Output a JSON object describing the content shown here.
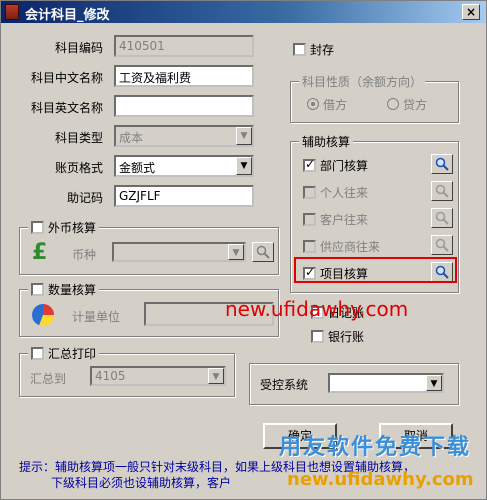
{
  "window": {
    "title": "会计科目_修改",
    "close_label": "×"
  },
  "fields": {
    "code_label": "科目编码",
    "code_value": "410501",
    "cn_name_label": "科目中文名称",
    "cn_name_value": "工资及福利费",
    "en_name_label": "科目英文名称",
    "en_name_value": "",
    "type_label": "科目类型",
    "type_value": "成本",
    "format_label": "账页格式",
    "format_value": "金额式",
    "mnemonic_label": "助记码",
    "mnemonic_value": "GZJFLF"
  },
  "seal": {
    "label": "封存"
  },
  "nature": {
    "title": "科目性质（余额方向）",
    "debit": "借方",
    "credit": "贷方"
  },
  "aux": {
    "title": "辅助核算",
    "items": [
      {
        "label": "部门核算",
        "checked": true,
        "enabled": true
      },
      {
        "label": "个人往来",
        "checked": false,
        "enabled": false
      },
      {
        "label": "客户往来",
        "checked": false,
        "enabled": false
      },
      {
        "label": "供应商往来",
        "checked": false,
        "enabled": false
      },
      {
        "label": "项目核算",
        "checked": true,
        "enabled": true
      }
    ]
  },
  "daily_journal": {
    "label": "日记账"
  },
  "bank_journal": {
    "label": "银行账"
  },
  "foreign": {
    "title": "外币核算",
    "currency_label": "币种"
  },
  "quantity": {
    "title": "数量核算",
    "unit_label": "计量单位"
  },
  "summary": {
    "title": "汇总打印",
    "to_label": "汇总到",
    "to_value": "4105"
  },
  "controlled": {
    "label": "受控系统",
    "value": ""
  },
  "buttons": {
    "ok": "确定",
    "cancel": "取消"
  },
  "hint": {
    "line1": "提示：辅助核算项一般只针对末级科目，如果上级科目也想设置辅助核算，",
    "line2": "下级科目必须也设辅助核算，客户"
  },
  "watermark": {
    "url": "new.ufidawhy.com",
    "brand": "用友软件免费下载",
    "url2": "new.ufidawhy.com"
  },
  "colors": {
    "title_bar": "#0a246a",
    "highlight": "#e00000",
    "dialog": "#d4d0c8"
  }
}
